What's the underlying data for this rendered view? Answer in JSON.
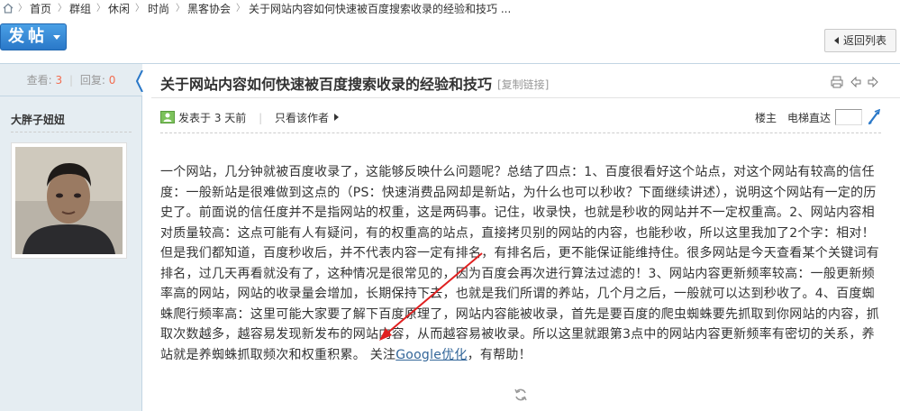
{
  "breadcrumb": {
    "items": [
      "首页",
      "群组",
      "休闲",
      "时尚",
      "黑客协会",
      "关于网站内容如何快速被百度搜索收录的经验和技巧 ..."
    ]
  },
  "toolbar": {
    "post_label": "发帖",
    "back_label": "返回列表"
  },
  "thread": {
    "views_label": "查看:",
    "views": "3",
    "replies_label": "回复:",
    "replies": "0",
    "title": "关于网站内容如何快速被百度搜索收录的经验和技巧",
    "copy_link": "[复制链接]"
  },
  "post": {
    "author": "大胖子妞妞",
    "posted_prefix": "发表于",
    "posted_time": "3 天前",
    "only_author": "只看该作者",
    "floor_label": "楼主",
    "jump_label": "电梯直达",
    "body": "一个网站，几分钟就被百度收录了，这能够反映什么问题呢？总结了四点：1、百度很看好这个站点，对这个网站有较高的信任度：一般新站是很难做到这点的（PS：快速消费品网却是新站，为什么也可以秒收？下面继续讲述），说明这个网站有一定的历史了。前面说的信任度并不是指网站的权重，这是两码事。记住，收录快，也就是秒收的网站并不一定权重高。2、网站内容相对质量较高：这点可能有人有疑问，有的权重高的站点，直接拷贝别的网站的内容，也能秒收，所以这里我加了2个字：相对！但是我们都知道，百度秒收后，并不代表内容一定有排名，有排名后，更不能保证能维持住。很多网站是今天查看某个关键词有排名，过几天再看就没有了，这种情况是很常见的，因为百度会再次进行算法过滤的！3、网站内容更新频率较高：一般更新频率高的网站，网站的收录量会增加，长期保持下去，也就是我们所谓的养站，几个月之后，一般就可以达到秒收了。4、百度蜘蛛爬行频率高：这里可能大家要了解下百度原理了，网站内容能被收录，首先是要百度的爬虫蜘蛛要先抓取到你网站的内容，抓取次数越多，越容易发现新发布的网站内容，从而越容易被收录。所以这里就跟第3点中的网站内容更新频率有密切的关系，养站就是养蜘蛛抓取频次和权重积累。  关注",
    "link_text": "Google优化",
    "body_tail": "，有帮助！"
  },
  "icons": {
    "home": "home-icon",
    "print": "print-icon",
    "prev": "prev-thread-icon",
    "next": "next-thread-icon",
    "online": "online-status-icon",
    "go": "go-icon",
    "refresh": "refresh-icon"
  },
  "colors": {
    "accent_blue": "#2a78c8",
    "stat_number": "#f26c4f",
    "sidebar_bg": "#e5edf2",
    "border": "#c2d5e3",
    "link": "#336699",
    "annotation_arrow": "#e02020"
  }
}
